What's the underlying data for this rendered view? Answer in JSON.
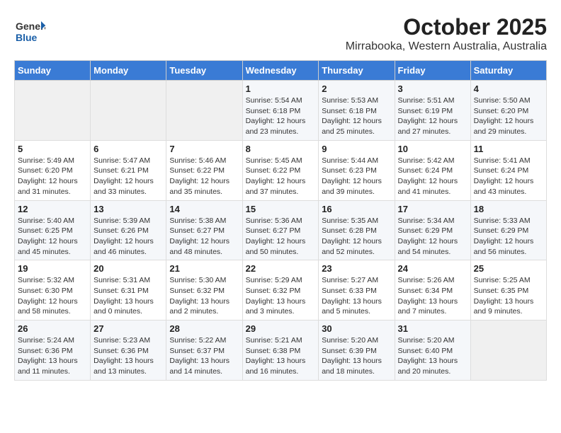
{
  "header": {
    "logo_general": "General",
    "logo_blue": "Blue",
    "title": "October 2025",
    "subtitle": "Mirrabooka, Western Australia, Australia"
  },
  "days_of_week": [
    "Sunday",
    "Monday",
    "Tuesday",
    "Wednesday",
    "Thursday",
    "Friday",
    "Saturday"
  ],
  "weeks": [
    [
      {
        "day": "",
        "info": ""
      },
      {
        "day": "",
        "info": ""
      },
      {
        "day": "",
        "info": ""
      },
      {
        "day": "1",
        "info": "Sunrise: 5:54 AM\nSunset: 6:18 PM\nDaylight: 12 hours\nand 23 minutes."
      },
      {
        "day": "2",
        "info": "Sunrise: 5:53 AM\nSunset: 6:18 PM\nDaylight: 12 hours\nand 25 minutes."
      },
      {
        "day": "3",
        "info": "Sunrise: 5:51 AM\nSunset: 6:19 PM\nDaylight: 12 hours\nand 27 minutes."
      },
      {
        "day": "4",
        "info": "Sunrise: 5:50 AM\nSunset: 6:20 PM\nDaylight: 12 hours\nand 29 minutes."
      }
    ],
    [
      {
        "day": "5",
        "info": "Sunrise: 5:49 AM\nSunset: 6:20 PM\nDaylight: 12 hours\nand 31 minutes."
      },
      {
        "day": "6",
        "info": "Sunrise: 5:47 AM\nSunset: 6:21 PM\nDaylight: 12 hours\nand 33 minutes."
      },
      {
        "day": "7",
        "info": "Sunrise: 5:46 AM\nSunset: 6:22 PM\nDaylight: 12 hours\nand 35 minutes."
      },
      {
        "day": "8",
        "info": "Sunrise: 5:45 AM\nSunset: 6:22 PM\nDaylight: 12 hours\nand 37 minutes."
      },
      {
        "day": "9",
        "info": "Sunrise: 5:44 AM\nSunset: 6:23 PM\nDaylight: 12 hours\nand 39 minutes."
      },
      {
        "day": "10",
        "info": "Sunrise: 5:42 AM\nSunset: 6:24 PM\nDaylight: 12 hours\nand 41 minutes."
      },
      {
        "day": "11",
        "info": "Sunrise: 5:41 AM\nSunset: 6:24 PM\nDaylight: 12 hours\nand 43 minutes."
      }
    ],
    [
      {
        "day": "12",
        "info": "Sunrise: 5:40 AM\nSunset: 6:25 PM\nDaylight: 12 hours\nand 45 minutes."
      },
      {
        "day": "13",
        "info": "Sunrise: 5:39 AM\nSunset: 6:26 PM\nDaylight: 12 hours\nand 46 minutes."
      },
      {
        "day": "14",
        "info": "Sunrise: 5:38 AM\nSunset: 6:27 PM\nDaylight: 12 hours\nand 48 minutes."
      },
      {
        "day": "15",
        "info": "Sunrise: 5:36 AM\nSunset: 6:27 PM\nDaylight: 12 hours\nand 50 minutes."
      },
      {
        "day": "16",
        "info": "Sunrise: 5:35 AM\nSunset: 6:28 PM\nDaylight: 12 hours\nand 52 minutes."
      },
      {
        "day": "17",
        "info": "Sunrise: 5:34 AM\nSunset: 6:29 PM\nDaylight: 12 hours\nand 54 minutes."
      },
      {
        "day": "18",
        "info": "Sunrise: 5:33 AM\nSunset: 6:29 PM\nDaylight: 12 hours\nand 56 minutes."
      }
    ],
    [
      {
        "day": "19",
        "info": "Sunrise: 5:32 AM\nSunset: 6:30 PM\nDaylight: 12 hours\nand 58 minutes."
      },
      {
        "day": "20",
        "info": "Sunrise: 5:31 AM\nSunset: 6:31 PM\nDaylight: 13 hours\nand 0 minutes."
      },
      {
        "day": "21",
        "info": "Sunrise: 5:30 AM\nSunset: 6:32 PM\nDaylight: 13 hours\nand 2 minutes."
      },
      {
        "day": "22",
        "info": "Sunrise: 5:29 AM\nSunset: 6:32 PM\nDaylight: 13 hours\nand 3 minutes."
      },
      {
        "day": "23",
        "info": "Sunrise: 5:27 AM\nSunset: 6:33 PM\nDaylight: 13 hours\nand 5 minutes."
      },
      {
        "day": "24",
        "info": "Sunrise: 5:26 AM\nSunset: 6:34 PM\nDaylight: 13 hours\nand 7 minutes."
      },
      {
        "day": "25",
        "info": "Sunrise: 5:25 AM\nSunset: 6:35 PM\nDaylight: 13 hours\nand 9 minutes."
      }
    ],
    [
      {
        "day": "26",
        "info": "Sunrise: 5:24 AM\nSunset: 6:36 PM\nDaylight: 13 hours\nand 11 minutes."
      },
      {
        "day": "27",
        "info": "Sunrise: 5:23 AM\nSunset: 6:36 PM\nDaylight: 13 hours\nand 13 minutes."
      },
      {
        "day": "28",
        "info": "Sunrise: 5:22 AM\nSunset: 6:37 PM\nDaylight: 13 hours\nand 14 minutes."
      },
      {
        "day": "29",
        "info": "Sunrise: 5:21 AM\nSunset: 6:38 PM\nDaylight: 13 hours\nand 16 minutes."
      },
      {
        "day": "30",
        "info": "Sunrise: 5:20 AM\nSunset: 6:39 PM\nDaylight: 13 hours\nand 18 minutes."
      },
      {
        "day": "31",
        "info": "Sunrise: 5:20 AM\nSunset: 6:40 PM\nDaylight: 13 hours\nand 20 minutes."
      },
      {
        "day": "",
        "info": ""
      }
    ]
  ]
}
